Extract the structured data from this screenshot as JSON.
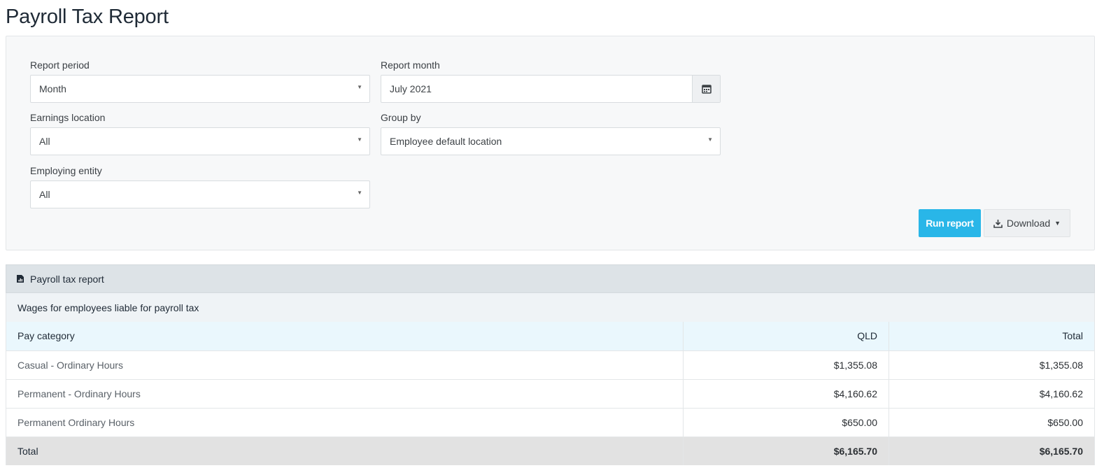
{
  "page": {
    "title": "Payroll Tax Report"
  },
  "filters": {
    "report_period": {
      "label": "Report period",
      "value": "Month"
    },
    "report_month": {
      "label": "Report month",
      "value": "July 2021"
    },
    "earnings_location": {
      "label": "Earnings location",
      "value": "All"
    },
    "group_by": {
      "label": "Group by",
      "value": "Employee default location"
    },
    "employing_entity": {
      "label": "Employing entity",
      "value": "All"
    }
  },
  "actions": {
    "run_report": "Run report",
    "download": "Download"
  },
  "report": {
    "title": "Payroll tax report",
    "subtitle": "Wages for employees liable for payroll tax",
    "columns": [
      "Pay category",
      "QLD",
      "Total"
    ],
    "rows": [
      {
        "category": "Casual - Ordinary Hours",
        "qld": "$1,355.08",
        "total": "$1,355.08"
      },
      {
        "category": "Permanent - Ordinary Hours",
        "qld": "$4,160.62",
        "total": "$4,160.62"
      },
      {
        "category": "Permanent Ordinary Hours",
        "qld": "$650.00",
        "total": "$650.00"
      }
    ],
    "total": {
      "label": "Total",
      "qld": "$6,165.70",
      "total": "$6,165.70"
    }
  },
  "icons": {
    "calendar": "calendar-icon",
    "download": "download-icon",
    "report": "report-icon",
    "caret": "chevron-down-icon"
  },
  "colors": {
    "primary": "#29b6e8",
    "header_bg": "#dde3e7",
    "column_header_bg": "#eaf7fd",
    "total_bg": "#e2e2e2"
  }
}
